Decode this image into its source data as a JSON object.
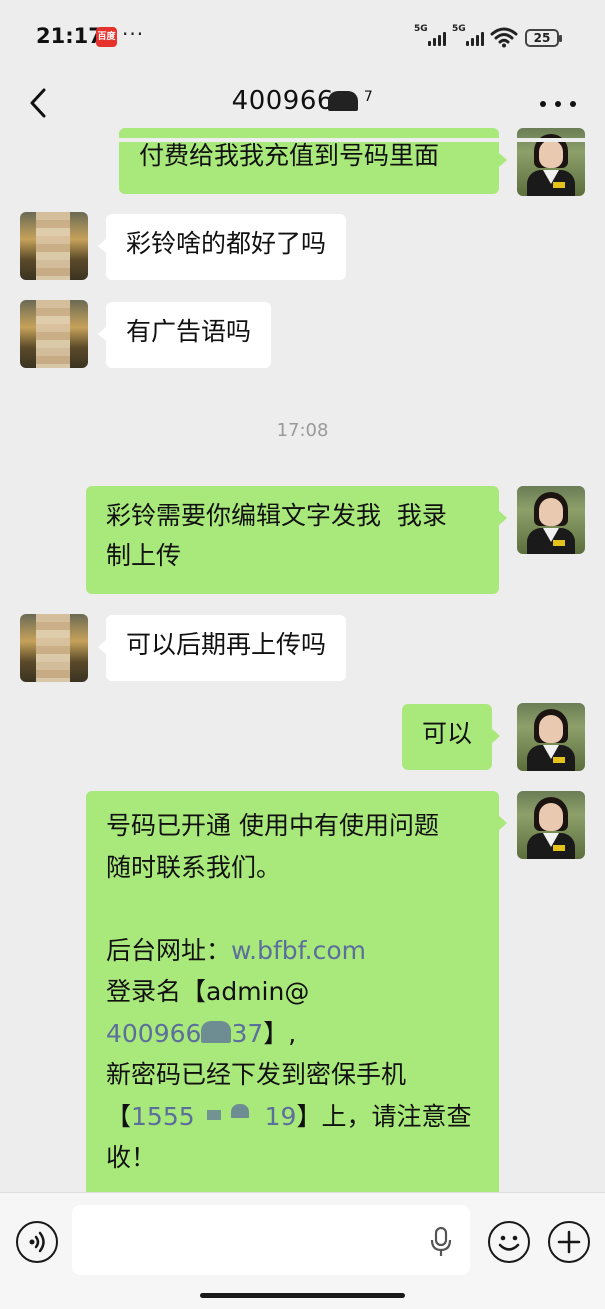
{
  "status_bar": {
    "time": "21:17",
    "notification_badge": "百度",
    "more": "···",
    "signal_1_label": "5G",
    "signal_2_label": "5G",
    "battery": "25"
  },
  "header": {
    "title": "400966",
    "title_obscured_suffix": "7"
  },
  "messages": [
    {
      "side": "sent",
      "text": "付费给我我充值到号码里面"
    },
    {
      "side": "recv",
      "text": "彩铃啥的都好了吗"
    },
    {
      "side": "recv",
      "text": "有广告语吗"
    },
    {
      "side": "time",
      "text": "17:08"
    },
    {
      "side": "sent",
      "text": "彩铃需要你编辑文字发我  我录\n制上传"
    },
    {
      "side": "recv",
      "text": "可以后期再上传吗"
    },
    {
      "side": "sent",
      "text": "可以"
    },
    {
      "side": "sent",
      "lines": {
        "l1": "号码已开通 使用中有使用问题",
        "l2": "随时联系我们。",
        "l3_label": "后台网址：",
        "l3_link": "w.bfbf.com",
        "l4": "登录名【admin@",
        "l5_link": "400966",
        "l5_link_end": "37",
        "l5_rest": "】,",
        "l6": "新密码已经下发到密保手机",
        "l7_open": "【",
        "l7_link": "1555",
        "l7_link_end": "19",
        "l7_rest": "】上，请注意查",
        "l8": "收！"
      }
    }
  ],
  "icons": {
    "back": "chevron-left-icon",
    "more": "more-dots-icon",
    "voice": "voice-icon",
    "mic": "mic-icon",
    "emoji": "emoji-icon",
    "plus": "plus-icon"
  },
  "colors": {
    "background": "#ededed",
    "sent_bubble": "#a9e87a",
    "recv_bubble": "#ffffff",
    "link": "#5b6f9c"
  }
}
